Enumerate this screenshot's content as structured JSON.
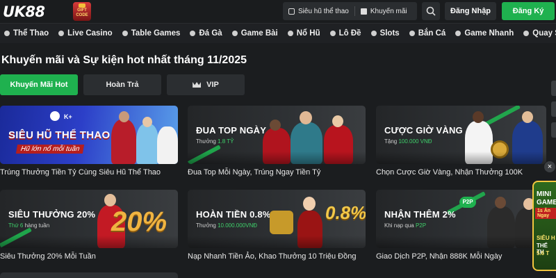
{
  "header": {
    "logo": "UK88",
    "gift_badge": "GIFT CODE",
    "links": [
      {
        "label": "Siêu hũ thể thao",
        "icon": "grid-icon"
      },
      {
        "label": "Khuyến mãi",
        "icon": "gift-icon"
      }
    ],
    "login_label": "Đăng Nhập",
    "register_label": "Đăng Ký"
  },
  "nav": {
    "items": [
      {
        "label": "Thể Thao"
      },
      {
        "label": "Live Casino"
      },
      {
        "label": "Table Games"
      },
      {
        "label": "Đá Gà"
      },
      {
        "label": "Game Bài"
      },
      {
        "label": "Nổ Hũ"
      },
      {
        "label": "Lô Đề"
      },
      {
        "label": "Slots"
      },
      {
        "label": "Bắn Cá"
      },
      {
        "label": "Game Nhanh"
      },
      {
        "label": "Quay Số"
      }
    ]
  },
  "main": {
    "title": "Khuyến mãi và Sự kiện hot nhất tháng 11/2025",
    "tabs": [
      {
        "label": "Khuyến Mãi Hot",
        "active": true
      },
      {
        "label": "Hoàn Trả",
        "active": false
      },
      {
        "label": "VIP",
        "active": false
      }
    ],
    "promos": [
      {
        "banner_title": "SIÊU HŨ THỂ THAO",
        "banner_sub": "Hũ lớn nổ mỗi tuần",
        "banner_logo": "K+",
        "caption": "Trúng Thưởng Tiền Tỷ Cùng Siêu Hũ Thể Thao"
      },
      {
        "banner_title": "ĐUA TOP NGÀY",
        "banner_sub_prefix": "Thưởng",
        "banner_sub_highlight": "1.8 TỶ",
        "caption": "Đua Top Mỗi Ngày, Trúng Ngay Tiền Tỷ"
      },
      {
        "banner_title": "CƯỢC GIỜ VÀNG",
        "banner_sub_prefix": "Tặng",
        "banner_sub_highlight": "100.000 VNĐ",
        "caption": "Chọn Cược Giờ Vàng, Nhận Thưởng 100K"
      },
      {
        "banner_title": "SIÊU THƯỞNG 20%",
        "banner_sub_highlight": "Thứ 6",
        "banner_sub_suffix": "hàng tuần",
        "banner_big": "20%",
        "caption": "Siêu Thưởng 20% Mỗi Tuần"
      },
      {
        "banner_title": "HOÀN TIỀN 0.8%",
        "banner_sub_prefix": "Thưởng",
        "banner_sub_highlight": "10.000.000VNĐ",
        "banner_big": "0.8%",
        "caption": "Nạp Nhanh Tiền Ảo, Khao Thưởng 10 Triệu Đồng"
      },
      {
        "banner_title": "NHẬN THÊM 2%",
        "banner_sub_prefix": "Khi nạp qua",
        "banner_sub_highlight": "P2P",
        "banner_badge": "P2P",
        "caption": "Giao Dịch P2P, Nhận 888K Mỗi Ngày"
      }
    ]
  },
  "side_widget": {
    "close_label": "×",
    "line1": "MINI",
    "line2": "GAME",
    "line3": "1s Ăn Ngay",
    "line4": "SIÊU H",
    "line5": "THỂ TH",
    "line6": "5.6 T"
  },
  "colors": {
    "accent": "#1fb14f",
    "background": "#1b1d1f",
    "panel": "#2b2e31"
  }
}
